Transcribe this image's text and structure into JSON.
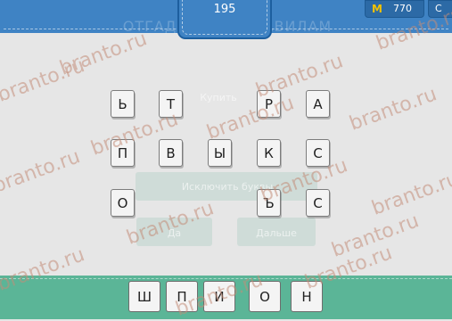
{
  "header": {
    "level_number": "195",
    "coins_icon": "М",
    "coins": "770",
    "extra_label": "С",
    "ghost_title": "ОТГАДАТЬ ПО ПРАВИЛАМ"
  },
  "ghost": {
    "hint_text": "Купить",
    "remove_letters": "Исключить буквы",
    "btn_left": "Да",
    "btn_right": "Дальше"
  },
  "letter_tiles": [
    {
      "letter": "Ь"
    },
    {
      "letter": "Т"
    },
    {
      "letter": "Р"
    },
    {
      "letter": "А"
    },
    {
      "letter": "П"
    },
    {
      "letter": "В"
    },
    {
      "letter": "Ы"
    },
    {
      "letter": "К"
    },
    {
      "letter": "С"
    },
    {
      "letter": "О"
    },
    {
      "letter": "Ъ"
    },
    {
      "letter": "С"
    }
  ],
  "answer": [
    "Ш",
    "П",
    "И",
    "О",
    "Н"
  ],
  "watermark": "branto.ru",
  "colors": {
    "top_bar": "#3f83c4",
    "bottom_bar": "#5bb597",
    "background": "#e6e6e6",
    "coin_icon": "#f2c200"
  }
}
